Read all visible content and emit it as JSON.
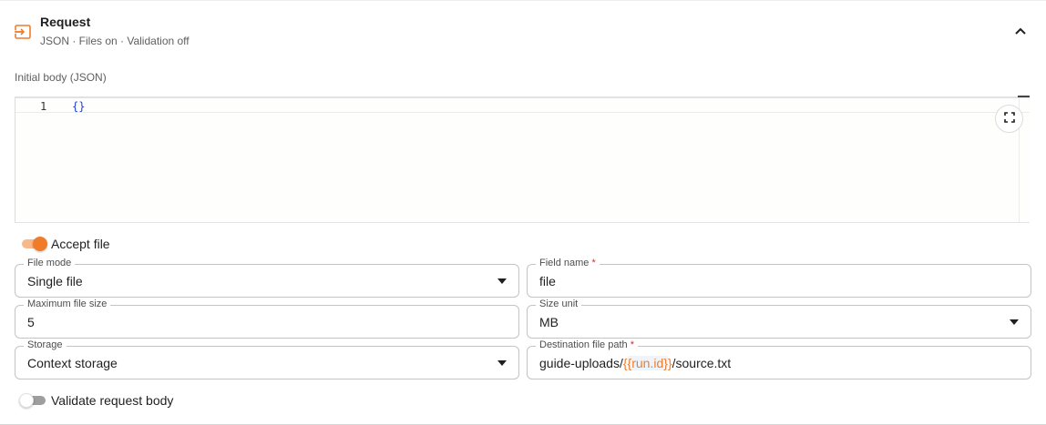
{
  "header": {
    "title": "Request",
    "subtitle": "JSON · Files on · Validation off",
    "icon": "input-arrow-icon",
    "collapse_icon": "chevron-up-icon"
  },
  "body_section": {
    "label": "Initial body (JSON)",
    "editor": {
      "line_number": "1",
      "content": "{}"
    },
    "fullscreen_icon": "fullscreen-icon"
  },
  "accept_file": {
    "label": "Accept file",
    "enabled": true
  },
  "fields": {
    "file_mode": {
      "label": "File mode",
      "value": "Single file"
    },
    "field_name": {
      "label": "Field name",
      "required_mark": "*",
      "value": "file"
    },
    "max_file_size": {
      "label": "Maximum file size",
      "value": "5"
    },
    "size_unit": {
      "label": "Size unit",
      "value": "MB"
    },
    "storage": {
      "label": "Storage",
      "value": "Context storage"
    },
    "destination_path": {
      "label": "Destination file path",
      "required_mark": "*",
      "value_prefix": "guide-uploads/",
      "template_open": "{",
      "template_body": "{run.id}",
      "template_close": "}",
      "value_suffix": "/source.txt"
    }
  },
  "validate": {
    "label": "Validate request body",
    "enabled": false
  },
  "colors": {
    "accent": "#f07c2a",
    "accent_light": "#f7b88a",
    "editor_code": "#1a3fd8",
    "required": "#d32f2f"
  }
}
